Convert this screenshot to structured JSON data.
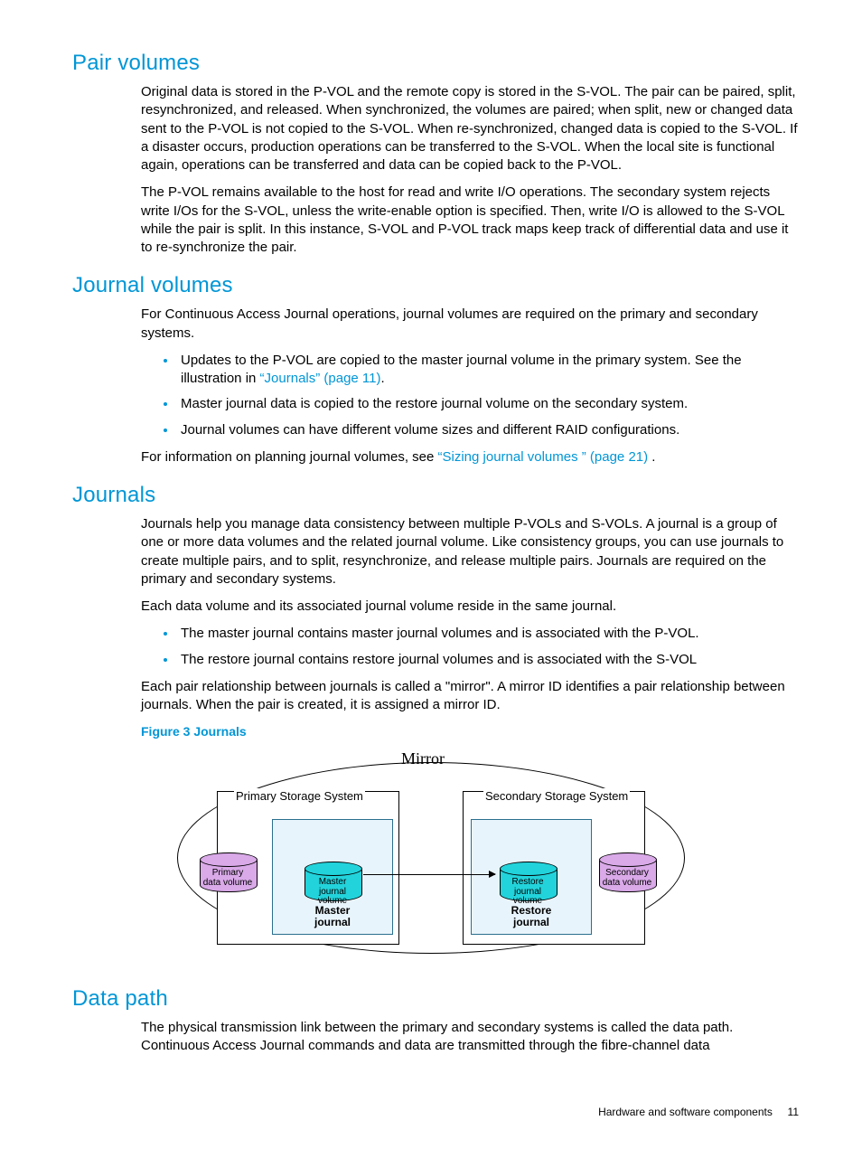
{
  "sections": {
    "pair_volumes": {
      "heading": "Pair volumes",
      "para1": "Original data is stored in the P-VOL and the remote copy is stored in the S-VOL. The pair can be paired, split, resynchronized, and released. When synchronized, the volumes are paired; when split, new or changed data sent to the P-VOL is not copied to the S-VOL. When re-synchronized, changed data is copied to the S-VOL. If a disaster occurs, production operations can be transferred to the S-VOL. When the local site is functional again, operations can be transferred and data can be copied back to the P-VOL.",
      "para2": "The P-VOL remains available to the host for read and write I/O operations. The secondary system rejects write I/Os for the S-VOL, unless the write-enable option is specified. Then, write I/O is allowed to the S-VOL while the pair is split. In this instance, S-VOL and P-VOL track maps keep track of differential data and use it to re-synchronize the pair."
    },
    "journal_volumes": {
      "heading": "Journal volumes",
      "intro": "For Continuous Access Journal operations, journal volumes are required on the primary and secondary systems.",
      "bullets": [
        {
          "pre": "Updates to the P-VOL are copied to the master journal volume in the primary system. See the illustration in ",
          "link": "“Journals” (page 11)",
          "post": "."
        },
        {
          "pre": "Master journal data is copied to the restore journal volume on the secondary system.",
          "link": "",
          "post": ""
        },
        {
          "pre": "Journal volumes can have different volume sizes and different RAID configurations.",
          "link": "",
          "post": ""
        }
      ],
      "outro_pre": "For information on planning journal volumes, see ",
      "outro_link": "“Sizing journal volumes ” (page 21)",
      "outro_post": " ."
    },
    "journals": {
      "heading": "Journals",
      "para1": "Journals help you manage data consistency between multiple P-VOLs and S-VOLs. A journal is a group of one or more data volumes and the related journal volume. Like consistency groups, you can use journals to create multiple pairs, and to split, resynchronize, and release multiple pairs. Journals are required on the primary and secondary systems.",
      "para2": "Each data volume and its associated journal volume reside in the same journal.",
      "bullets": [
        "The master journal contains master journal volumes and is associated with the P-VOL.",
        "The restore journal contains restore journal volumes and is associated with the S-VOL"
      ],
      "para3": "Each pair relationship between journals is called a \"mirror\". A mirror ID identifies a pair relationship between journals. When the pair is created, it is assigned a mirror ID.",
      "figure_caption": "Figure 3 Journals"
    },
    "data_path": {
      "heading": "Data path",
      "para1": "The physical transmission link between the primary and secondary systems is called the data path. Continuous Access Journal commands and data are transmitted through the fibre-channel data"
    }
  },
  "diagram": {
    "mirror": "Mirror",
    "primary_system": "Primary Storage System",
    "secondary_system": "Secondary Storage System",
    "primary_volume_l1": "Primary",
    "primary_volume_l2": "data volume",
    "master_jv_l1": "Master",
    "master_jv_l2": "journal volume",
    "master_journal_l1": "Master",
    "master_journal_l2": "journal",
    "restore_jv_l1": "Restore",
    "restore_jv_l2": "journal volume",
    "secondary_volume_l1": "Secondary",
    "secondary_volume_l2": "data volume",
    "restore_journal_l1": "Restore",
    "restore_journal_l2": "journal"
  },
  "footer": {
    "text": "Hardware and software components",
    "page": "11"
  }
}
